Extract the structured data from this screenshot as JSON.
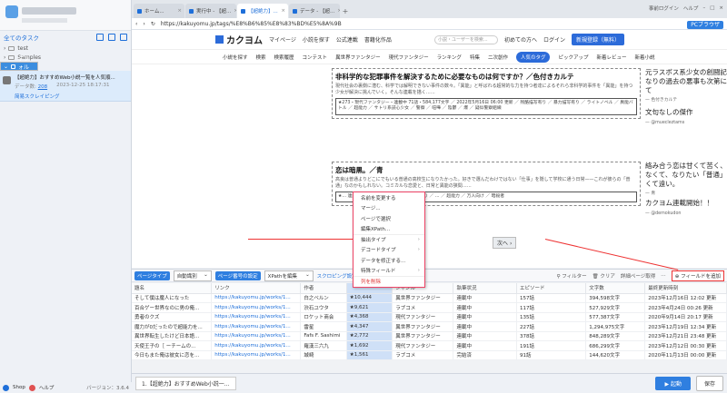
{
  "sidebar": {
    "header": "全てのタスク",
    "tree": [
      {
        "label": "test"
      },
      {
        "label": "Samples"
      },
      {
        "label": "デフォルト"
      }
    ],
    "task": {
      "title": "【超絶力】おすすめWeb小説一覧を人気順...",
      "count_label": "データ数:",
      "count": "208",
      "date": "2023-12-25 18:17:31",
      "running": "简易スクレイピング"
    },
    "shop": "Shop",
    "help": "ヘルプ",
    "version": "バージョン：3.6.4"
  },
  "tabs": [
    {
      "label": "ホーム..."
    },
    {
      "label": "実行中 - 【超..."
    },
    {
      "label": "【超絶力】..."
    },
    {
      "label": "データ - 【超..."
    }
  ],
  "toolbar_right": {
    "login": "事前ログイン",
    "help": "ヘルプ",
    "browser": "PCブラウザ"
  },
  "url": "https://kakuyomu.jp/tags/%E8%B6%85%E8%83%BD%E5%8A%9B",
  "site": {
    "logo": "カクヨム",
    "links": [
      "マイページ",
      "小説を探す",
      "公式連載",
      "書籍化作品"
    ],
    "search_placeholder": "小説・ユーザーを検索...",
    "first_time": "初めての方へ",
    "login": "ログイン",
    "register": "新規登録（無料）",
    "nav": [
      "小説を探す",
      "検索",
      "検索履歴",
      "コンテスト",
      "異世界ファンタジー",
      "現代ファンタジー",
      "ランキング",
      "特集",
      "二次創作",
      "人気のタグ",
      "ピックアップ",
      "新着レビュー",
      "新着小説"
    ],
    "nav_active_index": 9
  },
  "articles": [
    {
      "title": "非科学的な犯罪事件を解決するために必要なものは何ですか？／色付きカルテ",
      "desc": "現代社会の裏側に潜む、科学では解明できない事件の数々。「異能」と呼ばれる超常的な力を持つ者達によるそれら非科学的事件を「異能」を持つ少女が解決に挑んでいく。そんな連載を描く……",
      "tags": "★273・現代ファンタジー・連載中 71話・584,177文字 ／ 2022年5月16日 06:00 更新 ／ 残酷描写有り ／ 暴力描写有り ／ ライトノベル ／ 異能バトル ／ 超能力 ／ サトリ系読心少女 ／ 警察 ／ 喧嘩 ／ 陰鬱 ／ 爆 ／ 疑似警察組織"
    },
    {
      "title": "恋は暗黒。／青",
      "desc": "高良は普通よりどこにでもいる普通の高校生になりたかった。好きで選んだわけではない「仕事」を隠して学校に通う日常——これが彼らの「普通」なのかもしれない。コミカルな恋愛と、日常と異能の狭間……",
      "tags": "★… 連載中 … 506,296文字 ／ 残酷描写有り ／ … ／ 超能力 ／ 万人向け ／ 暗殺者"
    }
  ],
  "ads": [
    {
      "text": "元ラスボス系少女の創闘記。かなりの過去の悪事も次第にバレて",
      "by": "— 色付きカルテ"
    },
    {
      "text": "文句なしの傑作",
      "by": "— @muecleztams"
    },
    {
      "text": "絡み合う恋は甘くて苦く、せつなくて、なりたい「普通」は近くて遠い。",
      "by": "— 青"
    },
    {
      "text": "カクヨム連載開始！！",
      "by": "— @demokudon"
    }
  ],
  "next_button": "次へ",
  "context_menu": [
    {
      "label": "名前を変更する",
      "arrow": false
    },
    {
      "label": "マージ...",
      "arrow": false
    },
    {
      "label": "ページで選択",
      "arrow": false
    },
    {
      "label": "編集XPath...",
      "arrow": false
    },
    {
      "label": "抽出タイプ",
      "arrow": true
    },
    {
      "label": "デコードタイプ",
      "arrow": true
    },
    {
      "label": "データを修正する...",
      "arrow": false
    },
    {
      "label": "特殊フィールド",
      "arrow": true
    },
    {
      "label": "列を削除",
      "arrow": false,
      "danger": true
    }
  ],
  "data_toolbar": {
    "page_type": "ページタイプ",
    "page_type_value": "自動識別",
    "page_setting": "ページ番号の設定",
    "page_setting_value": "XPathを編集",
    "scroll_link": "スクロピング設定",
    "filter": "フィルター",
    "clear": "クリア",
    "detail": "詳細ページ取得",
    "add_field": "フィールドを追加",
    "badge": "有る"
  },
  "table": {
    "headers": [
      "題名",
      "リンク",
      "作者",
      "",
      "ジャンル",
      "執筆状況",
      "エピソード",
      "文字数",
      "最終更新時刻"
    ],
    "rows": [
      [
        "そして僕は魔人になった",
        "https://kakuyomu.jp/works/1...",
        "白之ベルン",
        "★10,444",
        "異世界ファンタジー",
        "連載中",
        "157話",
        "394,598文字",
        "2023年12月16日 12:02 更新"
      ],
      [
        "百合ゲー世界なのに男の俺...",
        "https://kakuyomu.jp/works/1...",
        "渋石ユウタ",
        "★9,621",
        "ラブコメ",
        "連載中",
        "117話",
        "527,929文字",
        "2023年4月24日 00:26 更新"
      ],
      [
        "勇者のクズ",
        "https://kakuyomu.jp/works/1...",
        "ロケット商会",
        "★4,368",
        "現代ファンタジー",
        "連載中",
        "135話",
        "577,387文字",
        "2020年9月14日 20:17 更新"
      ],
      [
        "魔力が0だったので超能力を...",
        "https://kakuyomu.jp/works/1...",
        "雷星",
        "★4,347",
        "異世界ファンタジー",
        "連載中",
        "227話",
        "1,294,975文字",
        "2023年12月19日 12:34 更新"
      ],
      [
        "異世界転生したけど日本語...",
        "https://kakuyomu.jp/works/1...",
        "Fafs F. Sashimi",
        "★2,772",
        "異世界ファンタジー",
        "連載中",
        "378話",
        "848,289文字",
        "2023年12月21日 23:48 更新"
      ],
      [
        "天使王子の［ ーチームの...",
        "https://kakuyomu.jp/works/1...",
        "羅漢三六九",
        "★1,692",
        "現代ファンタジー",
        "連載中",
        "191話",
        "686,299文字",
        "2023年12月12日 00:30 更新"
      ],
      [
        "今日もまた俺は彼女に恋を...",
        "https://kakuyomu.jp/works/1...",
        "城崎",
        "★1,561",
        "ラブコメ",
        "完結済",
        "91話",
        "144,620文字",
        "2020年11月13日 00:00 更新"
      ]
    ]
  },
  "bottom": {
    "task_tab": "1.【超絶力】おすすめWeb小説一...",
    "run": "▶ 起動",
    "save": "保存"
  }
}
